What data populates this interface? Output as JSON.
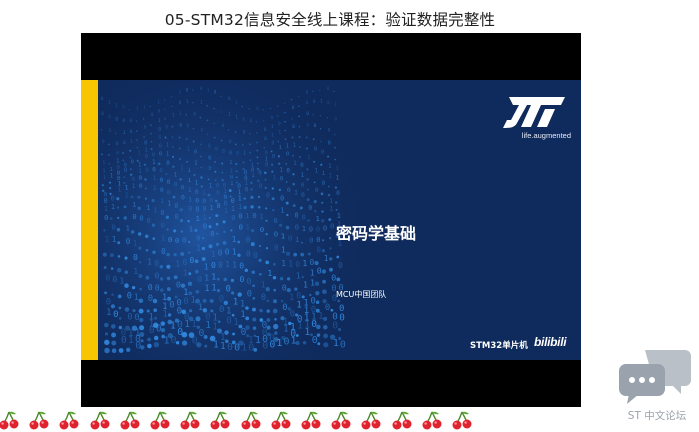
{
  "page": {
    "title": "05-STM32信息安全线上课程：验证数据完整性"
  },
  "video": {
    "slide": {
      "logo_name": "st-logo",
      "tagline": "life.augmented",
      "title": "密码学基础",
      "subtitle": "MCU中国团队",
      "brand": "STM32单片机",
      "platform_logo": "bilibili",
      "colors": {
        "background": "#0f2a5c",
        "accent_bar": "#f7c600",
        "binary_wave": "#3aa0ff"
      }
    }
  },
  "decoration": {
    "cherry_icon": "cherry-icon",
    "cherry_count": 16
  },
  "forum_widget": {
    "icon": "chat-bubbles-icon",
    "label": "ST 中文论坛",
    "color": "#9aa3ad"
  }
}
